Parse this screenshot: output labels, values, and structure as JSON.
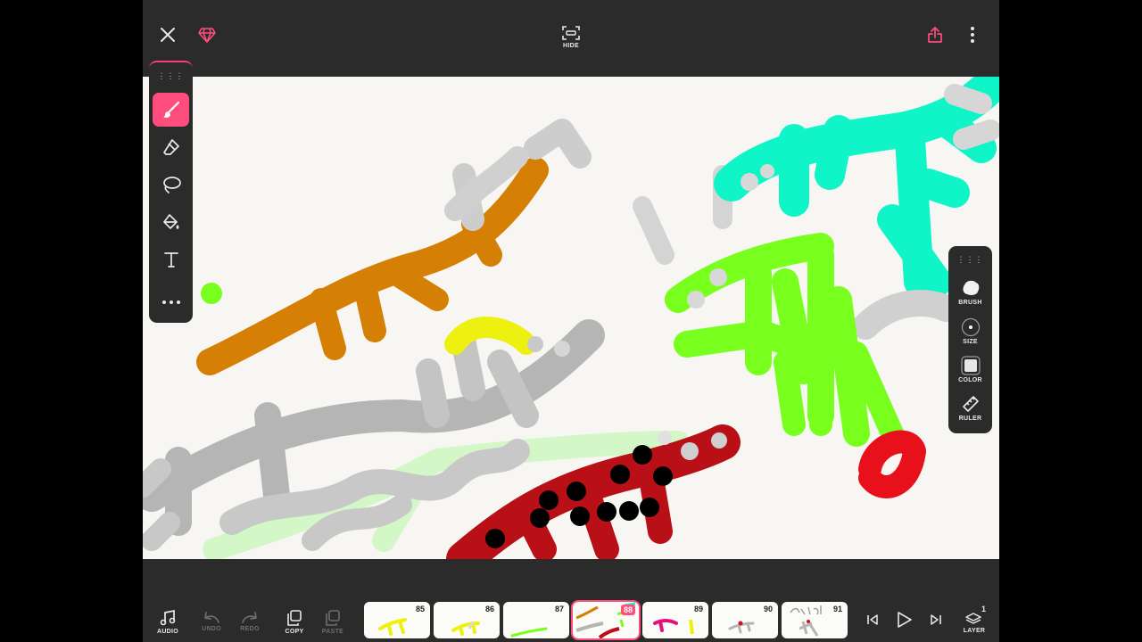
{
  "topbar": {
    "hide_label": "HIDE",
    "close_icon": "close-icon",
    "premium_icon": "diamond-icon",
    "share_icon": "share-icon",
    "more_icon": "more-vertical-icon"
  },
  "left_toolbar": {
    "tools": [
      {
        "name": "brush",
        "icon": "brush-icon",
        "active": true
      },
      {
        "name": "eraser",
        "icon": "eraser-icon",
        "active": false
      },
      {
        "name": "lasso",
        "icon": "lasso-icon",
        "active": false
      },
      {
        "name": "fill",
        "icon": "paint-bucket-icon",
        "active": false
      },
      {
        "name": "text",
        "icon": "text-icon",
        "active": false
      },
      {
        "name": "more",
        "icon": "more-horizontal-icon",
        "active": false
      }
    ]
  },
  "right_toolbar": {
    "brush_label": "BRUSH",
    "size_label": "SIZE",
    "color_label": "COLOR",
    "ruler_label": "RULER",
    "current_color": "#e6e6e6"
  },
  "bottombar": {
    "audio_label": "AUDIO",
    "undo_label": "UNDO",
    "redo_label": "REDO",
    "copy_label": "COPY",
    "paste_label": "PASTE",
    "layer_label": "LAYER",
    "layer_count": "1",
    "frames": [
      {
        "number": "85",
        "selected": false
      },
      {
        "number": "86",
        "selected": false
      },
      {
        "number": "87",
        "selected": false
      },
      {
        "number": "88",
        "selected": true
      },
      {
        "number": "89",
        "selected": false
      },
      {
        "number": "90",
        "selected": false
      },
      {
        "number": "91",
        "selected": false
      }
    ]
  },
  "colors": {
    "accent": "#ff4d7d",
    "ui_background": "#2b2b2b",
    "canvas": "#f7f6f2",
    "orange": "#d67f05",
    "cyan": "#10f5c8",
    "lime": "#78ff1e",
    "red": "#d0101e",
    "gray": "#b9b9b9",
    "yellow": "#efef10"
  }
}
